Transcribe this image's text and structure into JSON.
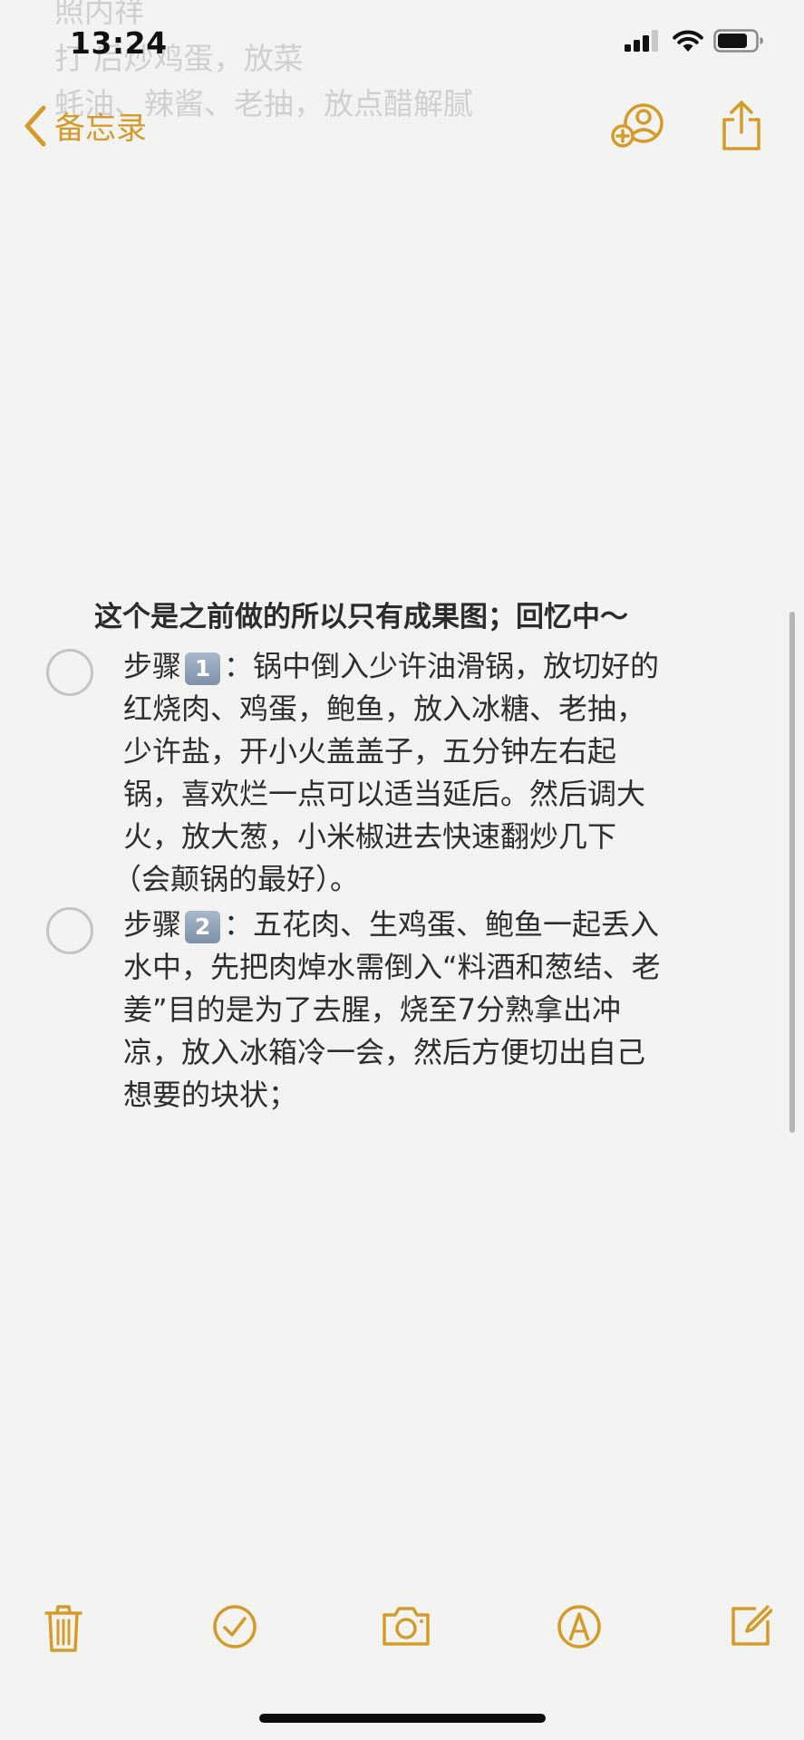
{
  "status_bar": {
    "time": "13:24"
  },
  "ghost_text": {
    "line1": "照内祥",
    "line2": "打           后炒鸡蛋，放菜",
    "line3": "蚝油、辣酱、老抽，放点醋解腻"
  },
  "nav": {
    "back_label": "备忘录",
    "icons": [
      "chevron-left-icon",
      "add-person-icon",
      "share-icon"
    ]
  },
  "note": {
    "heading": "这个是之前做的所以只有成果图；回忆中～",
    "items": [
      {
        "prefix": "步骤",
        "keycap": "1",
        "lines": [
          "：锅中倒入少许油滑锅，放切好的",
          "红烧肉、鸡蛋，鲍鱼，放入冰糖、老抽，",
          "少许盐，开小火盖盖子，五分钟左右起",
          "锅，喜欢烂一点可以适当延后。然后调大",
          "火，放大葱，小米椒进去快速翻炒几下",
          "（会颠锅的最好）。"
        ],
        "checked": false
      },
      {
        "prefix": "步骤",
        "keycap": "2",
        "lines": [
          "：五花肉、生鸡蛋、鲍鱼一起丢入",
          "水中，先把肉焯水需倒入“料酒和葱结、老",
          "姜”目的是为了去腥，烧至7分熟拿出冲",
          "凉，放入冰箱冷一会，然后方便切出自己",
          "想要的块状；"
        ],
        "checked": false
      }
    ]
  },
  "toolbar": {
    "icons": [
      "trash-icon",
      "checklist-icon",
      "camera-icon",
      "markup-icon",
      "compose-icon"
    ]
  },
  "colors": {
    "accent": "#d39b2a",
    "background": "#f4f4f2",
    "text": "#2d2d2d",
    "circle": "#c3c3c3"
  }
}
